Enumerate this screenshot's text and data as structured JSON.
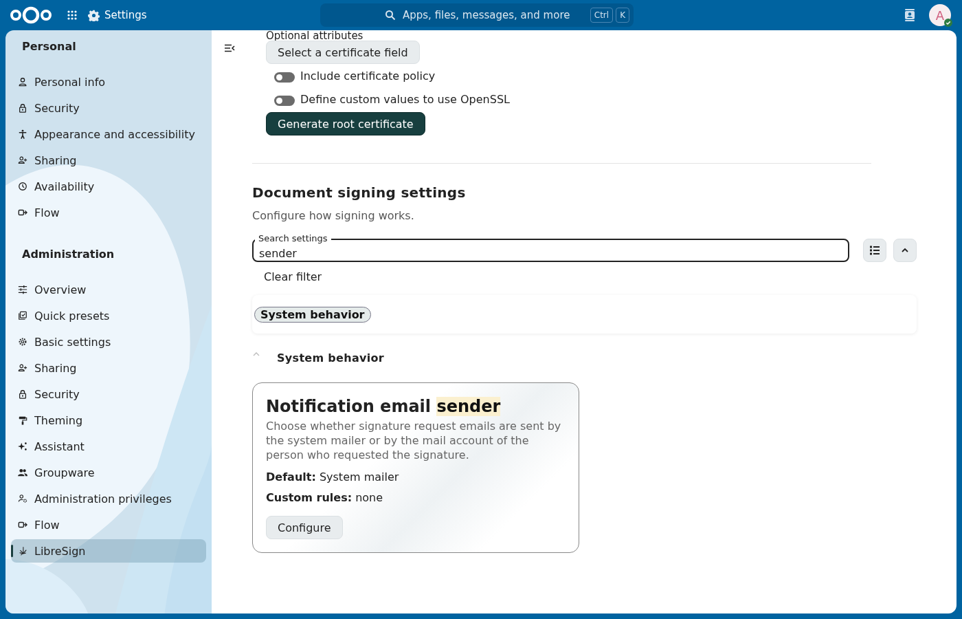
{
  "header": {
    "app_title": "Settings",
    "search": {
      "placeholder": "Apps, files, messages, and more",
      "shortcut_keys": [
        "Ctrl",
        "K"
      ]
    },
    "avatar": {
      "initial": "A",
      "online": true
    }
  },
  "sidebar": {
    "sections": [
      {
        "title": "Personal",
        "items": [
          {
            "label": "Personal info",
            "selected": false
          },
          {
            "label": "Security",
            "selected": false
          },
          {
            "label": "Appearance and accessibility",
            "selected": false
          },
          {
            "label": "Sharing",
            "selected": false
          },
          {
            "label": "Availability",
            "selected": false
          },
          {
            "label": "Flow",
            "selected": false
          }
        ]
      },
      {
        "title": "Administration",
        "items": [
          {
            "label": "Overview",
            "selected": false
          },
          {
            "label": "Quick presets",
            "selected": false
          },
          {
            "label": "Basic settings",
            "selected": false
          },
          {
            "label": "Sharing",
            "selected": false
          },
          {
            "label": "Security",
            "selected": false
          },
          {
            "label": "Theming",
            "selected": false
          },
          {
            "label": "Assistant",
            "selected": false
          },
          {
            "label": "Groupware",
            "selected": false
          },
          {
            "label": "Administration privileges",
            "selected": false
          },
          {
            "label": "Flow",
            "selected": false
          },
          {
            "label": "LibreSign",
            "selected": true
          }
        ]
      }
    ]
  },
  "certificate": {
    "optional_label": "Optional attributes",
    "select_button": "Select a certificate field",
    "toggles": [
      {
        "label": "Include certificate policy",
        "on": false
      },
      {
        "label": "Define custom values to use OpenSSL",
        "on": false
      }
    ],
    "generate_button": "Generate root certificate"
  },
  "signing": {
    "title": "Document signing settings",
    "description": "Configure how signing works.",
    "search": {
      "label": "Search settings",
      "value": "sender"
    },
    "clear_filter": "Clear filter",
    "chips": [
      {
        "label": "System behavior",
        "selected": true
      }
    ],
    "group": {
      "title": "System behavior",
      "expanded": true
    },
    "card": {
      "title": "Notification email ",
      "highlight": "sender",
      "description": "Choose whether signature request emails are sent by the system mailer or by the mail account of the person who requested the signature.",
      "lines": [
        "**Default:** System mailer",
        "**Custom rules:** none"
      ],
      "button": "Configure"
    }
  }
}
